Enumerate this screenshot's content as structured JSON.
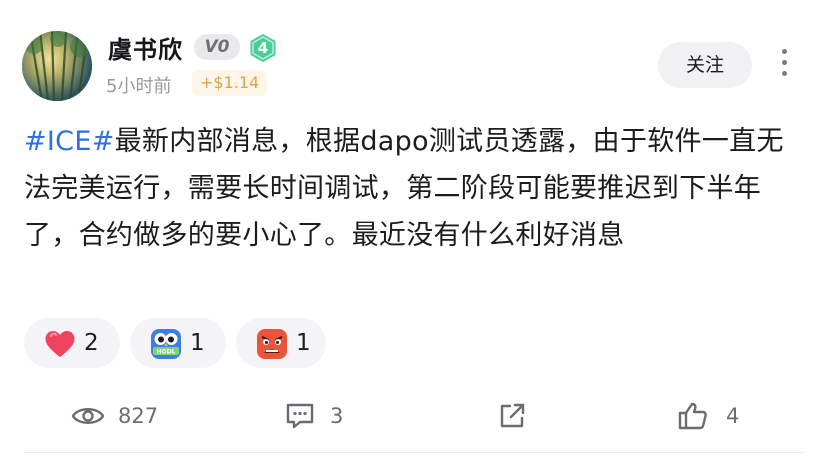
{
  "author": {
    "name": "虞书欣",
    "vip_badge": "V0",
    "level": "4",
    "time_ago": "5小时前",
    "reward": "+$1.14",
    "avatar_icon": "avatar-forest-sunlight"
  },
  "actions": {
    "follow_label": "关注",
    "more_icon": "more-vertical-icon"
  },
  "post": {
    "hashtag": "#ICE#",
    "text": "最新内部消息，根据dapo测试员透露，由于软件一直无法完美运行，需要长时间调试，第二阶段可能要推迟到下半年了，合约做多的要小心了。最近没有什么利好消息"
  },
  "reactions": [
    {
      "icon": "heart-icon",
      "count": "2"
    },
    {
      "icon": "hodl-owl-icon",
      "count": "1"
    },
    {
      "icon": "angry-face-icon",
      "count": "1"
    }
  ],
  "stats": {
    "views": "827",
    "comments": "3",
    "likes": "4"
  },
  "colors": {
    "hashtag": "#2f6fe4",
    "reward_text": "#e0a24a",
    "reward_bg": "#fdf6e8",
    "level_badge": "#4ecb9b",
    "heart": "#f0435f"
  }
}
